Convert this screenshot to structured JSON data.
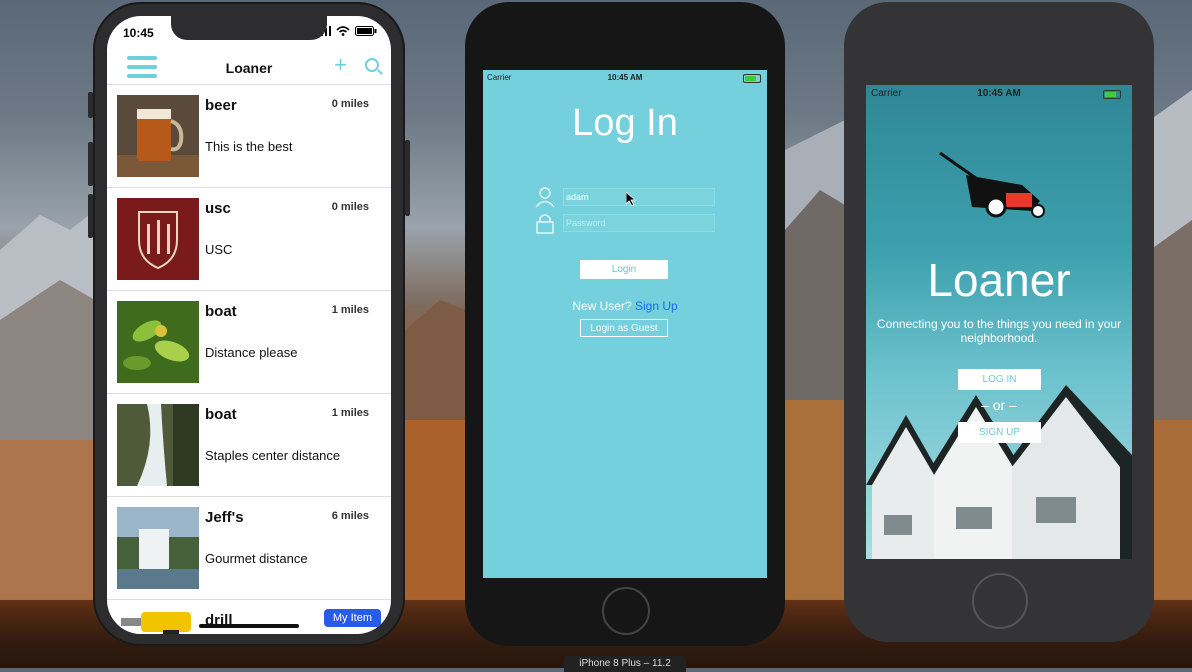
{
  "phone1": {
    "status": {
      "time": "10:45"
    },
    "nav": {
      "title": "Loaner"
    },
    "items": [
      {
        "title": "beer",
        "miles": "0 miles",
        "desc": "This is the best"
      },
      {
        "title": "usc",
        "miles": "0 miles",
        "desc": "USC"
      },
      {
        "title": "boat",
        "miles": "1 miles",
        "desc": "Distance please"
      },
      {
        "title": "boat",
        "miles": "1 miles",
        "desc": "Staples center distance"
      },
      {
        "title": "Jeff's",
        "miles": "6 miles",
        "desc": "Gourmet distance"
      },
      {
        "title": "drill",
        "badge": "My Item"
      }
    ]
  },
  "phone2": {
    "status": {
      "carrier": "Carrier",
      "time": "10:45 AM"
    },
    "title": "Log In",
    "username": {
      "value": "adam"
    },
    "password": {
      "placeholder": "Password"
    },
    "login_label": "Login",
    "new_user": "New User?",
    "sign_up": "Sign Up",
    "guest_label": "Login as Guest"
  },
  "phone3": {
    "status": {
      "carrier": "Carrier",
      "time": "10:45 AM"
    },
    "title": "Loaner",
    "tagline": "Connecting you to the things you need in your neighborhood.",
    "login_label": "LOG IN",
    "or_label": "– or –",
    "signup_label": "SIGN UP"
  },
  "simulator_label": "iPhone 8 Plus – 11.2"
}
